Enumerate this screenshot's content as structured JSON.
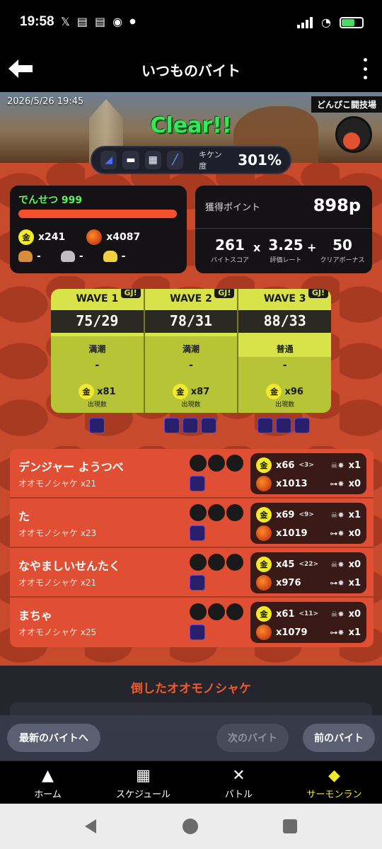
{
  "status": {
    "time": "19:58",
    "notif_icons": [
      "x-icon",
      "news-icon",
      "news-icon",
      "line-icon",
      "dot-icon"
    ]
  },
  "appbar": {
    "title": "いつものバイト"
  },
  "banner": {
    "datetime": "2026/5/26 19:45",
    "stage": "どんぴこ闘技場",
    "result": "Clear!!",
    "danger_label": "キケン度",
    "danger_value": "301%"
  },
  "summary": {
    "rank": "でんせつ 999",
    "golden_eggs": "x241",
    "power_eggs": "x4087",
    "scales": [
      {
        "color": "#d98a3a",
        "value": "-"
      },
      {
        "color": "#bfbfbf",
        "value": "-"
      },
      {
        "color": "#f2d23c",
        "value": "-"
      }
    ]
  },
  "points": {
    "label": "獲得ポイント",
    "value": "898p",
    "score": "261",
    "score_label": "バイトスコア",
    "rate": "3.25",
    "rate_label": "評価レート",
    "bonus": "50",
    "bonus_label": "クリアボーナス",
    "op_mult": "x",
    "op_plus": "+"
  },
  "waves": [
    {
      "title": "WAVE 1",
      "score": "75/29",
      "tide": "満潮",
      "event": "-",
      "appear": "x81",
      "appear_label": "出現数",
      "gj": "GJ!",
      "water": 0.62
    },
    {
      "title": "WAVE 2",
      "score": "78/31",
      "tide": "満潮",
      "event": "-",
      "appear": "x87",
      "appear_label": "出現数",
      "gj": "GJ!",
      "water": 0.62
    },
    {
      "title": "WAVE 3",
      "score": "88/33",
      "tide": "普通",
      "event": "-",
      "appear": "x96",
      "appear_label": "出現数",
      "gj": "GJ!",
      "water": 0.45
    }
  ],
  "players": [
    {
      "name": "デンジャー ようつべ",
      "boss": "オオモノシャケ x21",
      "golden": "x66",
      "assist": "<3>",
      "power": "x1013",
      "rescue": "x1",
      "rescued": "x0"
    },
    {
      "name": "た",
      "boss": "オオモノシャケ x23",
      "golden": "x69",
      "assist": "<9>",
      "power": "x1019",
      "rescue": "x1",
      "rescued": "x0"
    },
    {
      "name": "なやましいせんたく",
      "boss": "オオモノシャケ x21",
      "golden": "x45",
      "assist": "<22>",
      "power": "x976",
      "rescue": "x0",
      "rescued": "x1"
    },
    {
      "name": "まちゃ",
      "boss": "オオモノシャケ x25",
      "golden": "x61",
      "assist": "<11>",
      "power": "x1079",
      "rescue": "x0",
      "rescued": "x1"
    }
  ],
  "defeated": {
    "title": "倒したオオモノシャケ"
  },
  "pager": {
    "latest": "最新のバイトへ",
    "next": "次のバイト",
    "prev": "前のバイト"
  },
  "tabs": [
    {
      "label": "ホーム",
      "icon": "squid-icon"
    },
    {
      "label": "スケジュール",
      "icon": "calendar-icon"
    },
    {
      "label": "バトル",
      "icon": "battle-icon"
    },
    {
      "label": "サーモンラン",
      "icon": "salmon-icon"
    }
  ]
}
